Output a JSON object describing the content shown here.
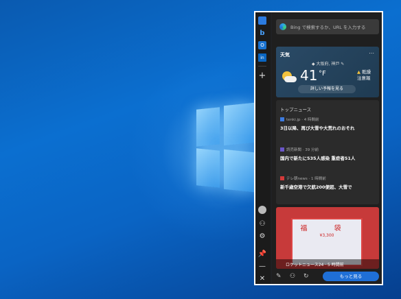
{
  "search": {
    "placeholder": "Bing で検索するか、URL を入力する"
  },
  "weather": {
    "title": "天気",
    "location": "大阪府, 神戸",
    "temp": "41",
    "unit": "°F",
    "alert_line1": "乾燥",
    "alert_line2": "注意報",
    "details_label": "詳しい予報を見る"
  },
  "news": {
    "header": "トップニュース",
    "items": [
      {
        "source": "tenki.jp · 4 時間前",
        "title": "3日以降、再び大雪や大荒れのおそれ"
      },
      {
        "source": "読売新聞 · 39 分前",
        "title": "国内で新たに535人感染 重症者51人"
      },
      {
        "source": "テレ朝news · 1 時間前",
        "title": "新千歳空港で欠航200便超、大雪で"
      }
    ]
  },
  "card": {
    "caption": "ロケットニュース24 · 5 時間前",
    "bag_text": "福 袋",
    "price_text": "¥3,300"
  },
  "footer": {
    "more_label": "もっと見る"
  }
}
